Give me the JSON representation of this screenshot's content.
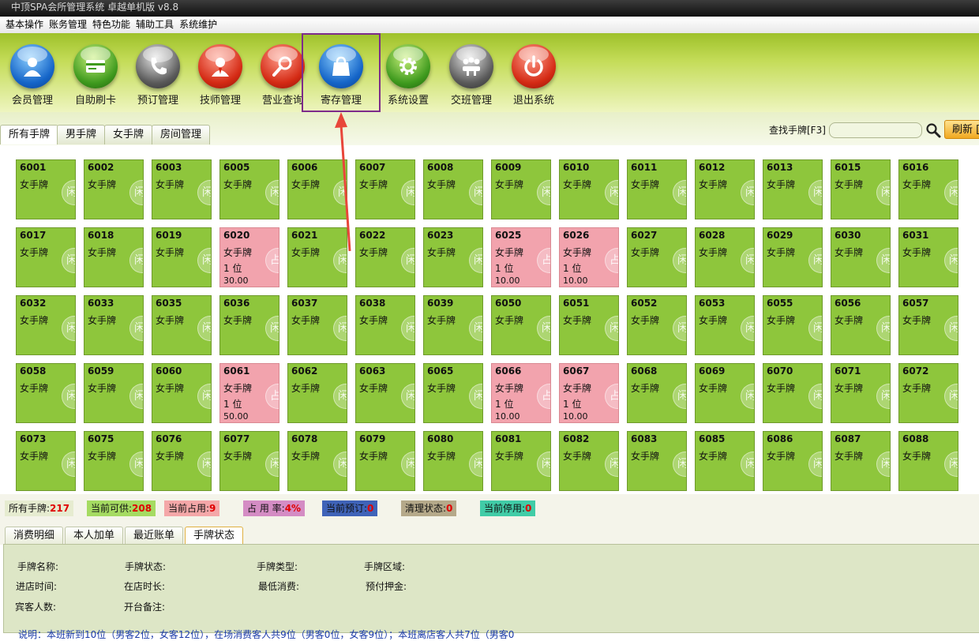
{
  "app": {
    "title": "中顶SPA会所管理系统 卓越单机版 v8.8"
  },
  "menu": [
    "基本操作",
    "账务管理",
    "特色功能",
    "辅助工具",
    "系统维护"
  ],
  "toolbar": [
    {
      "label": "会员管理",
      "icon": "member-icon",
      "color": "blue"
    },
    {
      "label": "自助刷卡",
      "icon": "card-icon",
      "color": "green"
    },
    {
      "label": "预订管理",
      "icon": "phone-icon",
      "color": "gray"
    },
    {
      "label": "技师管理",
      "icon": "technician-icon",
      "color": "red"
    },
    {
      "label": "营业查询",
      "icon": "magnifier-icon",
      "color": "red"
    },
    {
      "label": "寄存管理",
      "icon": "bag-icon",
      "color": "blue",
      "selected": true
    },
    {
      "label": "系统设置",
      "icon": "gear-icon",
      "color": "green"
    },
    {
      "label": "交班管理",
      "icon": "meeting-icon",
      "color": "gray"
    },
    {
      "label": "退出系统",
      "icon": "power-icon",
      "color": "red"
    }
  ],
  "tabs": [
    "所有手牌",
    "男手牌",
    "女手牌",
    "房间管理"
  ],
  "search": {
    "label": "查找手牌[F3]",
    "value": "",
    "refresh": "刷新 ["
  },
  "cards": [
    [
      {
        "n": "6001",
        "t": "女手牌"
      },
      {
        "n": "6002",
        "t": "女手牌"
      },
      {
        "n": "6003",
        "t": "女手牌"
      },
      {
        "n": "6005",
        "t": "女手牌"
      },
      {
        "n": "6006",
        "t": "女手牌"
      },
      {
        "n": "6007",
        "t": "女手牌"
      },
      {
        "n": "6008",
        "t": "女手牌"
      },
      {
        "n": "6009",
        "t": "女手牌"
      },
      {
        "n": "6010",
        "t": "女手牌"
      },
      {
        "n": "6011",
        "t": "女手牌"
      },
      {
        "n": "6012",
        "t": "女手牌"
      },
      {
        "n": "6013",
        "t": "女手牌"
      },
      {
        "n": "6015",
        "t": "女手牌"
      },
      {
        "n": "6016",
        "t": "女手牌"
      }
    ],
    [
      {
        "n": "6017",
        "t": "女手牌"
      },
      {
        "n": "6018",
        "t": "女手牌"
      },
      {
        "n": "6019",
        "t": "女手牌"
      },
      {
        "n": "6020",
        "t": "女手牌",
        "occ": true,
        "c": "1 位",
        "a": "30.00"
      },
      {
        "n": "6021",
        "t": "女手牌"
      },
      {
        "n": "6022",
        "t": "女手牌"
      },
      {
        "n": "6023",
        "t": "女手牌"
      },
      {
        "n": "6025",
        "t": "女手牌",
        "occ": true,
        "c": "1 位",
        "a": "10.00"
      },
      {
        "n": "6026",
        "t": "女手牌",
        "occ": true,
        "c": "1 位",
        "a": "10.00"
      },
      {
        "n": "6027",
        "t": "女手牌"
      },
      {
        "n": "6028",
        "t": "女手牌"
      },
      {
        "n": "6029",
        "t": "女手牌"
      },
      {
        "n": "6030",
        "t": "女手牌"
      },
      {
        "n": "6031",
        "t": "女手牌"
      }
    ],
    [
      {
        "n": "6032",
        "t": "女手牌"
      },
      {
        "n": "6033",
        "t": "女手牌"
      },
      {
        "n": "6035",
        "t": "女手牌"
      },
      {
        "n": "6036",
        "t": "女手牌"
      },
      {
        "n": "6037",
        "t": "女手牌"
      },
      {
        "n": "6038",
        "t": "女手牌"
      },
      {
        "n": "6039",
        "t": "女手牌"
      },
      {
        "n": "6050",
        "t": "女手牌"
      },
      {
        "n": "6051",
        "t": "女手牌"
      },
      {
        "n": "6052",
        "t": "女手牌"
      },
      {
        "n": "6053",
        "t": "女手牌"
      },
      {
        "n": "6055",
        "t": "女手牌"
      },
      {
        "n": "6056",
        "t": "女手牌"
      },
      {
        "n": "6057",
        "t": "女手牌"
      }
    ],
    [
      {
        "n": "6058",
        "t": "女手牌"
      },
      {
        "n": "6059",
        "t": "女手牌"
      },
      {
        "n": "6060",
        "t": "女手牌"
      },
      {
        "n": "6061",
        "t": "女手牌",
        "occ": true,
        "c": "1 位",
        "a": "50.00"
      },
      {
        "n": "6062",
        "t": "女手牌"
      },
      {
        "n": "6063",
        "t": "女手牌"
      },
      {
        "n": "6065",
        "t": "女手牌"
      },
      {
        "n": "6066",
        "t": "女手牌",
        "occ": true,
        "c": "1 位",
        "a": "10.00"
      },
      {
        "n": "6067",
        "t": "女手牌",
        "occ": true,
        "c": "1 位",
        "a": "10.00"
      },
      {
        "n": "6068",
        "t": "女手牌"
      },
      {
        "n": "6069",
        "t": "女手牌"
      },
      {
        "n": "6070",
        "t": "女手牌"
      },
      {
        "n": "6071",
        "t": "女手牌"
      },
      {
        "n": "6072",
        "t": "女手牌"
      }
    ],
    [
      {
        "n": "6073",
        "t": "女手牌"
      },
      {
        "n": "6075",
        "t": "女手牌"
      },
      {
        "n": "6076",
        "t": "女手牌"
      },
      {
        "n": "6077",
        "t": "女手牌"
      },
      {
        "n": "6078",
        "t": "女手牌"
      },
      {
        "n": "6079",
        "t": "女手牌"
      },
      {
        "n": "6080",
        "t": "女手牌"
      },
      {
        "n": "6081",
        "t": "女手牌"
      },
      {
        "n": "6082",
        "t": "女手牌"
      },
      {
        "n": "6083",
        "t": "女手牌"
      },
      {
        "n": "6085",
        "t": "女手牌"
      },
      {
        "n": "6086",
        "t": "女手牌"
      },
      {
        "n": "6087",
        "t": "女手牌"
      },
      {
        "n": "6088",
        "t": "女手牌"
      }
    ]
  ],
  "stamps": {
    "free": "闲",
    "occupied": "占"
  },
  "status": [
    {
      "label": "所有手牌:",
      "value": "217",
      "bg": "#e6ecd0"
    },
    {
      "label": "当前可供:",
      "value": "208",
      "bg": "#a5db62"
    },
    {
      "label": "当前占用:",
      "value": "9",
      "bg": "#f4a7a8"
    },
    {
      "label": "占 用 率:",
      "value": "4%",
      "bg": "#d48cc4"
    },
    {
      "label": "当前预订:",
      "value": "0",
      "bg": "#3f63b8"
    },
    {
      "label": "清理状态:",
      "value": "0",
      "bg": "#b5a98a"
    },
    {
      "label": "当前停用:",
      "value": "0",
      "bg": "#41cca7"
    }
  ],
  "bottom_tabs": [
    "消费明细",
    "本人加单",
    "最近账单",
    "手牌状态"
  ],
  "details": {
    "f1": "手牌名称:",
    "f2": "手牌状态:",
    "f3": "手牌类型:",
    "f4": "手牌区域:",
    "f5": "进店时间:",
    "f6": "在店时长:",
    "f7": "最低消费:",
    "f8": "预付押金:",
    "f9": "宾客人数:",
    "f10": "开台备注:",
    "note": "说明：本班新到10位（男客2位，女客12位），在场消费客人共9位（男客0位，女客9位）；本班离店客人共7位（男客0"
  }
}
